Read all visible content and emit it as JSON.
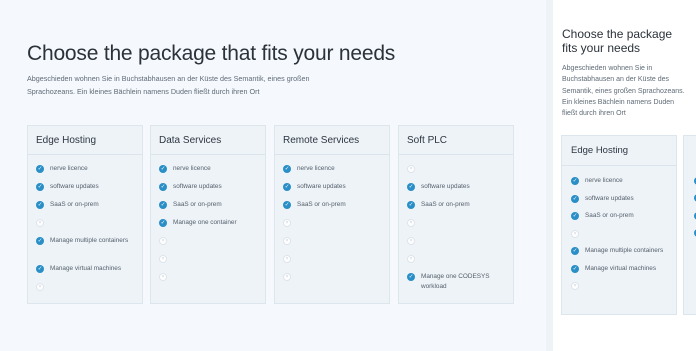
{
  "left": {
    "title": "Choose the package that fits your needs",
    "subtitle_line1": "Abgeschieden wohnen Sie in Buchstabhausen an der Küste des Semantik, eines großen",
    "subtitle_line2": "Sprachozeans. Ein kleines Bächlein namens Duden fließt durch ihren Ort",
    "cards": [
      {
        "name": "Edge Hosting",
        "features": [
          {
            "label": "nerve licence",
            "included": true
          },
          {
            "label": "software updates",
            "included": true
          },
          {
            "label": "SaaS or on-prem",
            "included": true
          },
          {
            "label": "",
            "included": false
          },
          {
            "label": "Manage multiple containers",
            "included": true
          },
          {
            "label": "Manage virtual  machines",
            "included": true
          },
          {
            "label": "",
            "included": false
          }
        ]
      },
      {
        "name": "Data Services",
        "features": [
          {
            "label": "nerve licence",
            "included": true
          },
          {
            "label": "software updates",
            "included": true
          },
          {
            "label": "SaaS or on-prem",
            "included": true
          },
          {
            "label": "Manage one container",
            "included": true
          },
          {
            "label": "",
            "included": false
          },
          {
            "label": "",
            "included": false
          },
          {
            "label": "",
            "included": false
          }
        ]
      },
      {
        "name": "Remote Services",
        "features": [
          {
            "label": "nerve licence",
            "included": true
          },
          {
            "label": "software updates",
            "included": true
          },
          {
            "label": "SaaS or on-prem",
            "included": true
          },
          {
            "label": "",
            "included": false
          },
          {
            "label": "",
            "included": false
          },
          {
            "label": "",
            "included": false
          },
          {
            "label": "",
            "included": false
          }
        ]
      },
      {
        "name": "Soft PLC",
        "features": [
          {
            "label": "",
            "included": false
          },
          {
            "label": "software updates",
            "included": true
          },
          {
            "label": "SaaS or on-prem",
            "included": true
          },
          {
            "label": "",
            "included": false
          },
          {
            "label": "",
            "included": false
          },
          {
            "label": "",
            "included": false
          },
          {
            "label": "Manage one CODESYS workload",
            "included": true
          }
        ]
      }
    ]
  },
  "right": {
    "title_line1": "Choose the package",
    "title_line2": "fits your needs",
    "subtitle_lines": [
      "Abgeschieden wohnen Sie in",
      "Buchstabhausen an der Küste des",
      "Semantik, eines großen Sprachozeans.",
      "Ein kleines Bächlein namens Duden",
      "fließt durch ihren Ort"
    ],
    "card": {
      "name": "Edge Hosting",
      "features": [
        {
          "label": "nerve licence",
          "included": true
        },
        {
          "label": "software updates",
          "included": true
        },
        {
          "label": "SaaS or on-prem",
          "included": true
        },
        {
          "label": "",
          "included": false
        },
        {
          "label": "Manage multiple containers",
          "included": true
        },
        {
          "label": "Manage virtual  machines",
          "included": true
        },
        {
          "label": "",
          "included": false
        }
      ]
    }
  },
  "icons": {
    "included": "check-icon",
    "excluded": "empty-circle-icon"
  },
  "colors": {
    "accent": "#2a8fc7",
    "background": "#f5f9fd",
    "card": "#eef3f8"
  }
}
